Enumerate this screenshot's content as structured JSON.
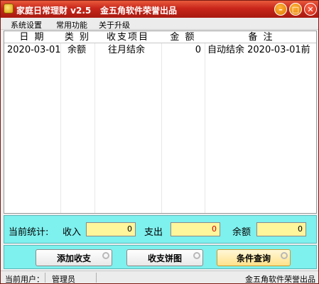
{
  "window": {
    "title": "家庭日常理财 v2.5",
    "subtitle": "金五角软件荣誉出品"
  },
  "menu": {
    "items": [
      "系统设置",
      "常用功能",
      "关于升级"
    ]
  },
  "table": {
    "headers": [
      "日 期",
      "类 别",
      "收支项目",
      "金 额",
      "备 注"
    ],
    "rows": [
      [
        "2020-03-01",
        "余额",
        "往月结余",
        "0",
        "自动结余 2020-03-01前"
      ]
    ]
  },
  "stats": {
    "label": "当前统计:",
    "income_label": "收入",
    "income_value": "0",
    "expense_label": "支出",
    "expense_value": "0",
    "balance_label": "余额",
    "balance_value": "0",
    "colors": {
      "panel": "#7ef0ee",
      "box": "#fff59a",
      "expense_text": "#d00000"
    }
  },
  "actions": {
    "add_label": "添加收支",
    "pie_label": "收支饼图",
    "query_label": "条件查询"
  },
  "status": {
    "user_label": "当前用户：",
    "user_value": "管理员",
    "vendor": "金五角软件荣誉出品"
  },
  "icons": [
    "app-icon",
    "minimize-icon",
    "maximize-icon",
    "close-icon",
    "gear-icon"
  ]
}
